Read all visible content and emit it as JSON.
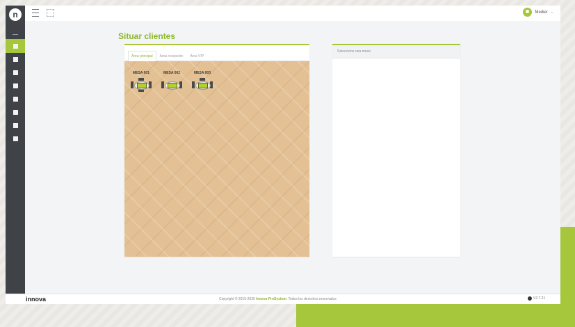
{
  "brand": {
    "logo_letter": "n",
    "footer_logo": "innova"
  },
  "sidebar": {
    "items": [
      {
        "icon": "users-icon",
        "active": true
      },
      {
        "icon": "home-icon",
        "active": false
      },
      {
        "icon": "chart-icon",
        "active": false
      },
      {
        "icon": "building-icon",
        "active": false
      },
      {
        "icon": "document-icon",
        "active": false
      },
      {
        "icon": "database-icon",
        "active": false
      },
      {
        "icon": "printer-icon",
        "active": false
      },
      {
        "icon": "shield-icon",
        "active": false
      }
    ]
  },
  "topbar": {
    "user_name": "Medier",
    "caret": "⌄"
  },
  "page": {
    "title": "Situar clientes"
  },
  "tabs": [
    {
      "label": "Área principal",
      "active": true
    },
    {
      "label": "Área recepción",
      "active": false
    },
    {
      "label": "Área VIP",
      "active": false
    }
  ],
  "tables": [
    {
      "label": "MESA 001",
      "chairs": [
        "t",
        "b",
        "l",
        "r"
      ]
    },
    {
      "label": "MESA 002",
      "chairs": [
        "l",
        "r"
      ]
    },
    {
      "label": "MESA 003",
      "chairs": [
        "t",
        "l",
        "r"
      ]
    }
  ],
  "detail": {
    "placeholder": "Seleccione una mesa"
  },
  "footer": {
    "copyright_prefix": "Copyright © 2015-2025",
    "brand_link": "Innova ProSystem",
    "copyright_suffix": ". Todos los derechos reservados",
    "version": "V2.7.21"
  },
  "colors": {
    "accent": "#a6c63c",
    "sidebar": "#3f4247",
    "floor": "#e3c195"
  }
}
